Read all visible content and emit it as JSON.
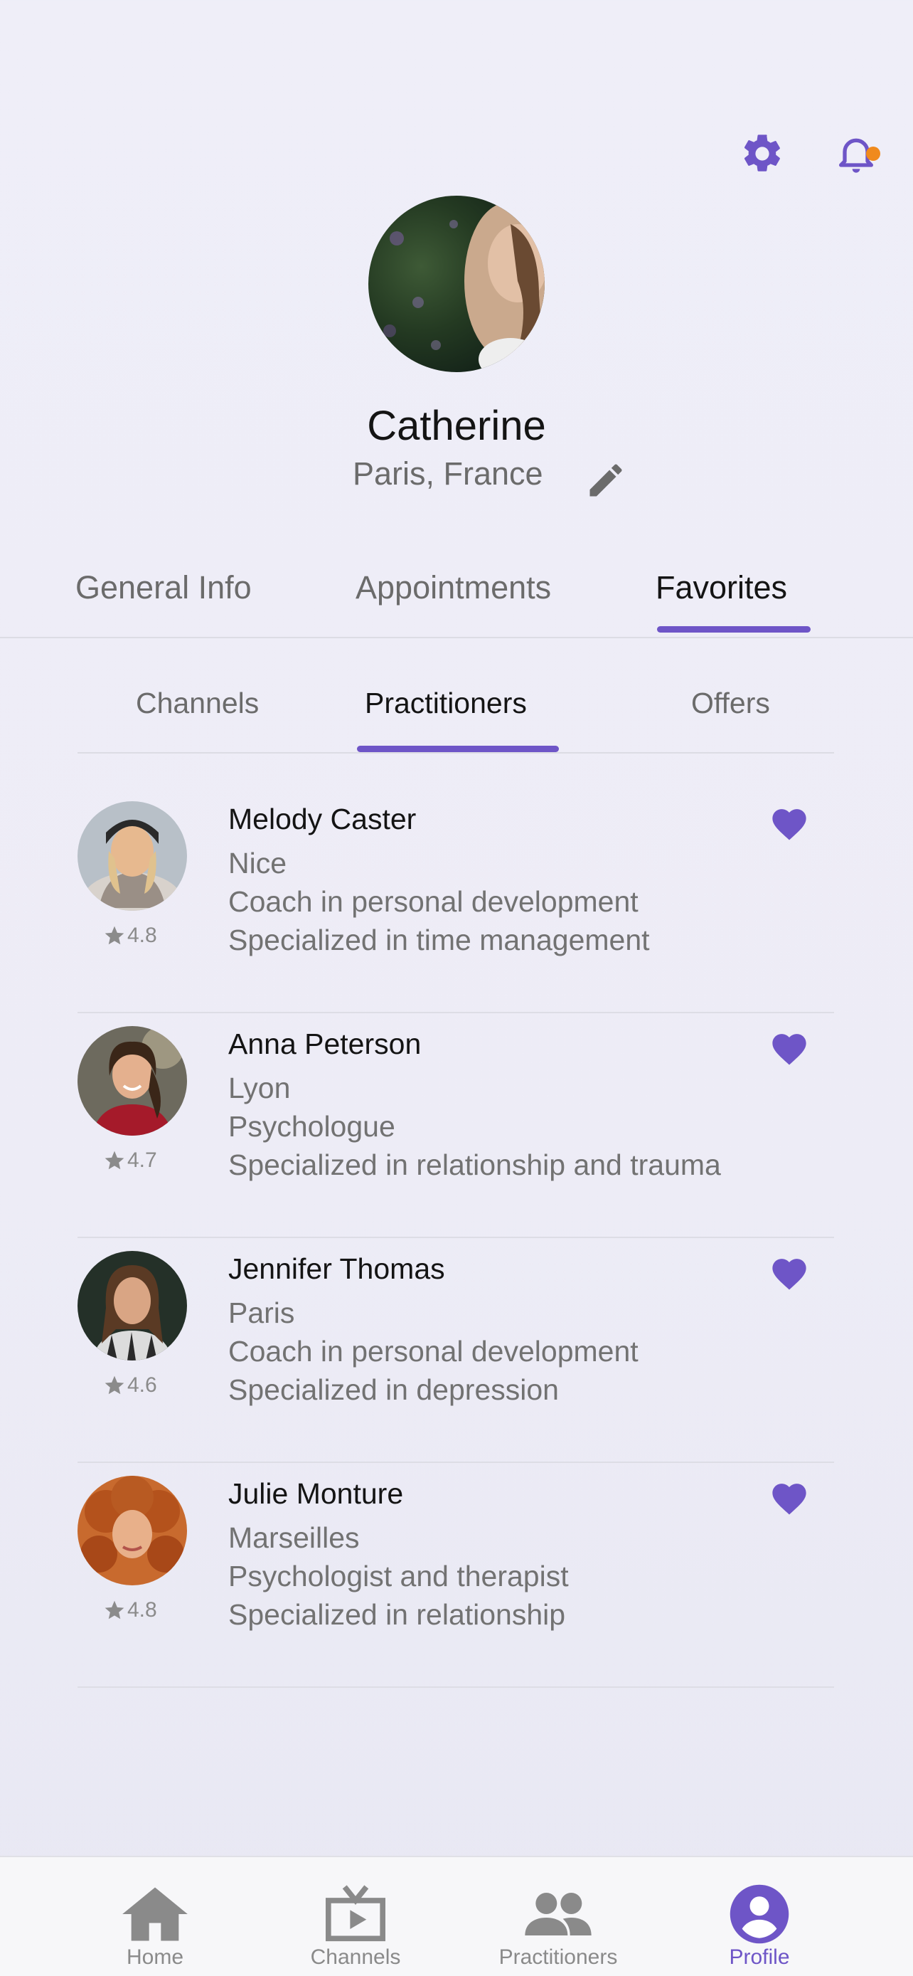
{
  "colors": {
    "accent": "#6e55c7",
    "notification": "#f08a1d",
    "icon_grey": "#8a8a8a"
  },
  "header": {
    "settings_icon": "gear-icon",
    "notifications_icon": "bell-icon"
  },
  "profile": {
    "name": "Catherine",
    "location": "Paris, France",
    "edit_icon": "pencil-icon"
  },
  "main_tabs": [
    {
      "label": "General Info",
      "active": false
    },
    {
      "label": "Appointments",
      "active": false
    },
    {
      "label": "Favorites",
      "active": true
    }
  ],
  "sub_tabs": [
    {
      "label": "Channels",
      "active": false
    },
    {
      "label": "Practitioners",
      "active": true
    },
    {
      "label": "Offers",
      "active": false
    }
  ],
  "practitioners": [
    {
      "name": "Melody Caster",
      "city": "Nice",
      "role": "Coach in personal development",
      "specialty": "Specialized in time management",
      "rating": "4.8",
      "favorite": true
    },
    {
      "name": "Anna Peterson",
      "city": "Lyon",
      "role": "Psychologue",
      "specialty": "Specialized in relationship and trauma",
      "rating": "4.7",
      "favorite": true
    },
    {
      "name": "Jennifer Thomas",
      "city": "Paris",
      "role": "Coach in personal development",
      "specialty": "Specialized in depression",
      "rating": "4.6",
      "favorite": true
    },
    {
      "name": "Julie Monture",
      "city": "Marseilles",
      "role": "Psychologist and therapist",
      "specialty": "Specialized in relationship",
      "rating": "4.8",
      "favorite": true
    }
  ],
  "bottom_nav": [
    {
      "label": "Home",
      "icon": "home-icon",
      "active": false
    },
    {
      "label": "Channels",
      "icon": "tv-icon",
      "active": false
    },
    {
      "label": "Practitioners",
      "icon": "people-icon",
      "active": false
    },
    {
      "label": "Profile",
      "icon": "user-circle-icon",
      "active": true
    }
  ]
}
